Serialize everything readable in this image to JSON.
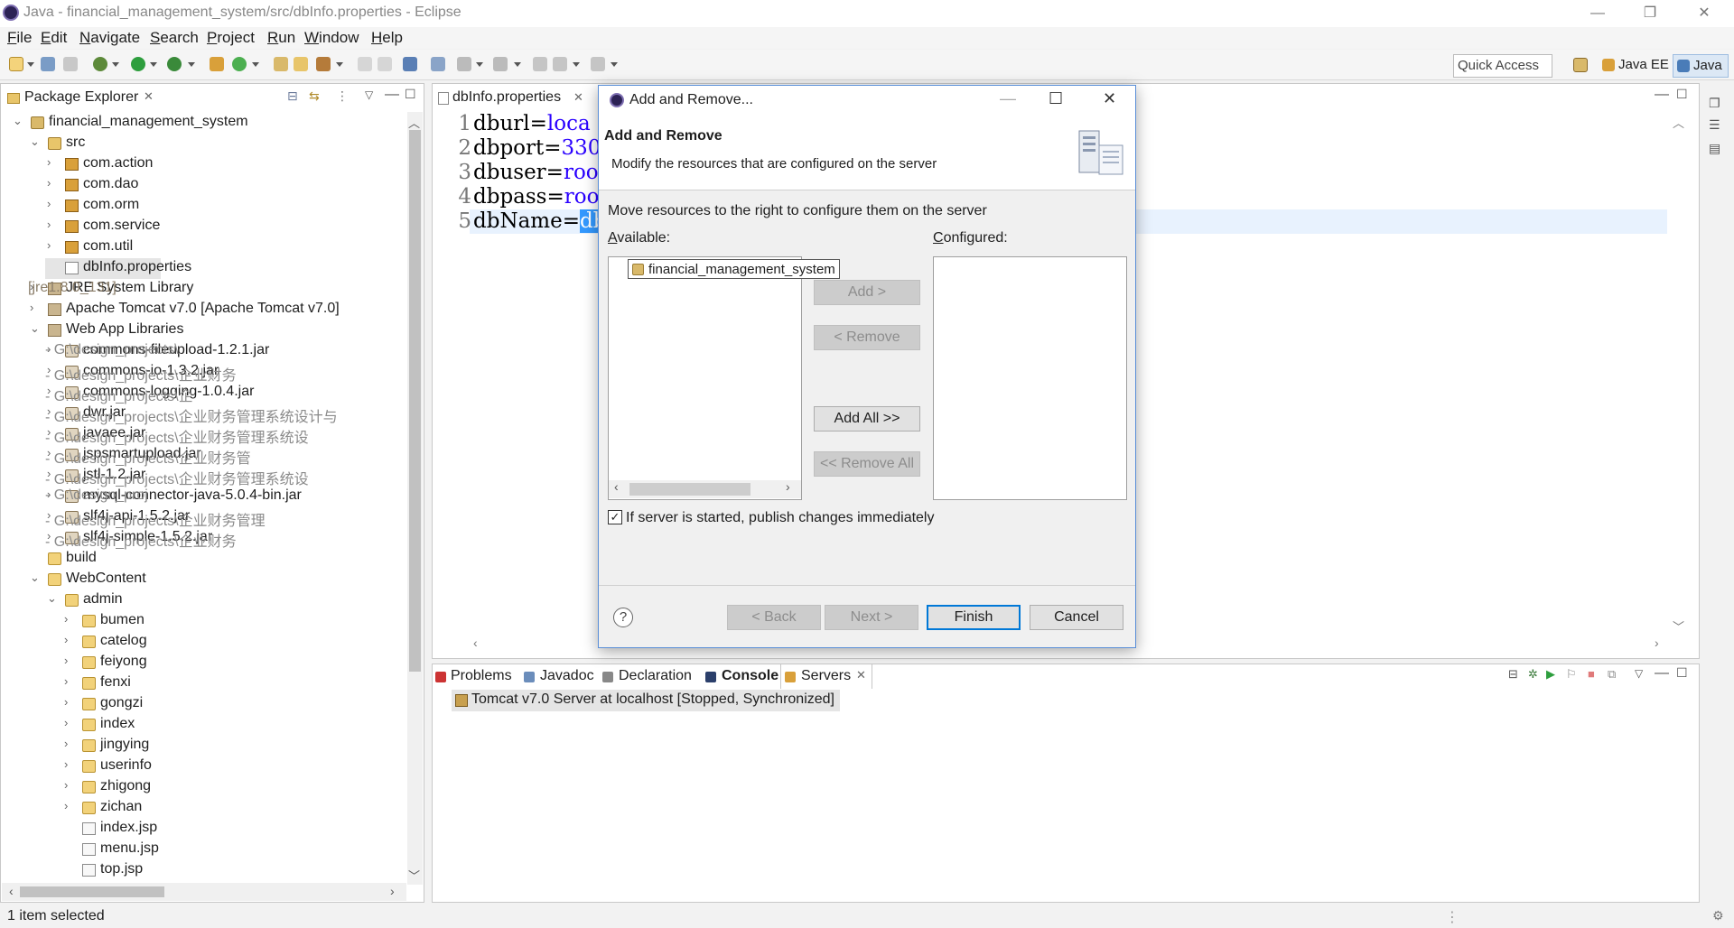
{
  "window": {
    "title": "Java - financial_management_system/src/dbInfo.properties - Eclipse",
    "minimize": "—",
    "restore": "❐",
    "close": "✕"
  },
  "menu": [
    {
      "label": "File",
      "mn": "F",
      "rest": "ile"
    },
    {
      "label": "Edit",
      "mn": "E",
      "rest": "dit"
    },
    {
      "label": "Navigate",
      "mn": "N",
      "rest": "avigate"
    },
    {
      "label": "Search",
      "mn": "S",
      "rest": "earch"
    },
    {
      "label": "Project",
      "mn": "P",
      "rest": "roject"
    },
    {
      "label": "Run",
      "mn": "R",
      "rest": "un"
    },
    {
      "label": "Window",
      "mn": "W",
      "rest": "indow"
    },
    {
      "label": "Help",
      "mn": "H",
      "rest": "elp"
    }
  ],
  "toolbar": {
    "quick_access": "Quick Access",
    "perspectives": [
      "Java EE",
      "Java"
    ]
  },
  "package_explorer": {
    "tab_label": "Package Explorer",
    "tree": [
      {
        "label": "financial_management_system",
        "extra": "",
        "depth": 0,
        "icon": "project",
        "expanded": true
      },
      {
        "label": "src",
        "extra": "",
        "depth": 1,
        "icon": "src",
        "expanded": true
      },
      {
        "label": "com.action",
        "extra": "",
        "depth": 2,
        "icon": "pkg",
        "expanded": false
      },
      {
        "label": "com.dao",
        "extra": "",
        "depth": 2,
        "icon": "pkg",
        "expanded": false
      },
      {
        "label": "com.orm",
        "extra": "",
        "depth": 2,
        "icon": "pkg",
        "expanded": false
      },
      {
        "label": "com.service",
        "extra": "",
        "depth": 2,
        "icon": "pkg",
        "expanded": false
      },
      {
        "label": "com.util",
        "extra": "",
        "depth": 2,
        "icon": "pkg",
        "expanded": false
      },
      {
        "label": "dbInfo.properties",
        "extra": "",
        "depth": 2,
        "icon": "file",
        "leaf": true,
        "selected": true
      },
      {
        "label": "JRE System Library",
        "extra": " [jre1.8.0_131]",
        "extraClass": "dim",
        "depth": 1,
        "icon": "lib",
        "expanded": false
      },
      {
        "label": "Apache Tomcat v7.0 [Apache Tomcat v7.0]",
        "extra": "",
        "depth": 1,
        "icon": "lib",
        "expanded": false
      },
      {
        "label": "Web App Libraries",
        "extra": "",
        "depth": 1,
        "icon": "lib",
        "expanded": true
      },
      {
        "label": "commons-fileupload-1.2.1.jar",
        "extra": " - G:\\design_projects\\",
        "extraClass": "gray",
        "depth": 2,
        "icon": "jar",
        "expanded": false
      },
      {
        "label": "commons-io-1.3.2.jar",
        "extra": " - G:\\design_projects\\企业财务",
        "extraClass": "gray",
        "depth": 2,
        "icon": "jar",
        "expanded": false
      },
      {
        "label": "commons-logging-1.0.4.jar",
        "extra": " - G:\\design_projects\\企",
        "extraClass": "gray",
        "depth": 2,
        "icon": "jar",
        "expanded": false
      },
      {
        "label": "dwr.jar",
        "extra": " - G:\\design_projects\\企业财务管理系统设计与",
        "extraClass": "gray",
        "depth": 2,
        "icon": "jar",
        "expanded": false
      },
      {
        "label": "javaee.jar",
        "extra": " - G:\\design_projects\\企业财务管理系统设",
        "extraClass": "gray",
        "depth": 2,
        "icon": "jar",
        "expanded": false
      },
      {
        "label": "jspsmartupload.jar",
        "extra": " - G:\\design_projects\\企业财务管",
        "extraClass": "gray",
        "depth": 2,
        "icon": "jar",
        "expanded": false
      },
      {
        "label": "jstl-1.2.jar",
        "extra": " - G:\\design_projects\\企业财务管理系统设",
        "extraClass": "gray",
        "depth": 2,
        "icon": "jar",
        "expanded": false
      },
      {
        "label": "mysql-connector-java-5.0.4-bin.jar",
        "extra": " - G:\\design_proj",
        "extraClass": "gray",
        "depth": 2,
        "icon": "jar",
        "expanded": false
      },
      {
        "label": "slf4j-api-1.5.2.jar",
        "extra": " - G:\\design_projects\\企业财务管理",
        "extraClass": "gray",
        "depth": 2,
        "icon": "jar",
        "expanded": false
      },
      {
        "label": "slf4j-simple-1.5.2.jar",
        "extra": " - G:\\design_projects\\企业财务",
        "extraClass": "gray",
        "depth": 2,
        "icon": "jar",
        "expanded": false
      },
      {
        "label": "build",
        "extra": "",
        "depth": 1,
        "icon": "folder",
        "leaf": true
      },
      {
        "label": "WebContent",
        "extra": "",
        "depth": 1,
        "icon": "folder",
        "expanded": true
      },
      {
        "label": "admin",
        "extra": "",
        "depth": 2,
        "icon": "folder",
        "expanded": true
      },
      {
        "label": "bumen",
        "extra": "",
        "depth": 3,
        "icon": "folder",
        "expanded": false
      },
      {
        "label": "catelog",
        "extra": "",
        "depth": 3,
        "icon": "folder",
        "expanded": false
      },
      {
        "label": "feiyong",
        "extra": "",
        "depth": 3,
        "icon": "folder",
        "expanded": false
      },
      {
        "label": "fenxi",
        "extra": "",
        "depth": 3,
        "icon": "folder",
        "expanded": false
      },
      {
        "label": "gongzi",
        "extra": "",
        "depth": 3,
        "icon": "folder",
        "expanded": false
      },
      {
        "label": "index",
        "extra": "",
        "depth": 3,
        "icon": "folder",
        "expanded": false
      },
      {
        "label": "jingying",
        "extra": "",
        "depth": 3,
        "icon": "folder",
        "expanded": false
      },
      {
        "label": "userinfo",
        "extra": "",
        "depth": 3,
        "icon": "folder",
        "expanded": false
      },
      {
        "label": "zhigong",
        "extra": "",
        "depth": 3,
        "icon": "folder",
        "expanded": false
      },
      {
        "label": "zichan",
        "extra": "",
        "depth": 3,
        "icon": "folder",
        "expanded": false
      },
      {
        "label": "index.jsp",
        "extra": "",
        "depth": 3,
        "icon": "jsp",
        "leaf": true
      },
      {
        "label": "menu.jsp",
        "extra": "",
        "depth": 3,
        "icon": "jsp",
        "leaf": true
      },
      {
        "label": "top.jsp",
        "extra": "",
        "depth": 3,
        "icon": "jsp",
        "leaf": true
      }
    ]
  },
  "editor": {
    "tab_label": "dbInfo.properties",
    "lines": [
      {
        "n": "1",
        "key": "dburl=",
        "val": "loca",
        "sel": ""
      },
      {
        "n": "2",
        "key": "dbport=",
        "val": "330",
        "sel": ""
      },
      {
        "n": "3",
        "key": "dbuser=",
        "val": "roo",
        "sel": ""
      },
      {
        "n": "4",
        "key": "dbpass=",
        "val": "roo",
        "sel": ""
      },
      {
        "n": "5",
        "key": "dbName=",
        "val": "",
        "sel": "db"
      }
    ]
  },
  "bottom_panel": {
    "tabs": [
      "Problems",
      "Javadoc",
      "Declaration",
      "Console",
      "Servers"
    ],
    "server_entry": "Tomcat v7.0 Server at localhost  [Stopped, Synchronized]"
  },
  "status": {
    "text": "1 item selected"
  },
  "dialog": {
    "title": "Add and Remove...",
    "header_title": "Add and Remove",
    "header_desc": "Modify the resources that are configured on the server",
    "instruction": "Move resources to the right to configure them on the server",
    "available_label": "Available:",
    "configured_label": "Configured:",
    "available_items": [
      "financial_management_system"
    ],
    "buttons": {
      "add": "Add >",
      "remove": "< Remove",
      "add_all": "Add All >>",
      "remove_all": "<< Remove All",
      "back": "< Back",
      "next": "Next >",
      "finish": "Finish",
      "cancel": "Cancel"
    },
    "checkbox_label": "If server is started, publish changes immediately",
    "checkbox_checked": true
  }
}
